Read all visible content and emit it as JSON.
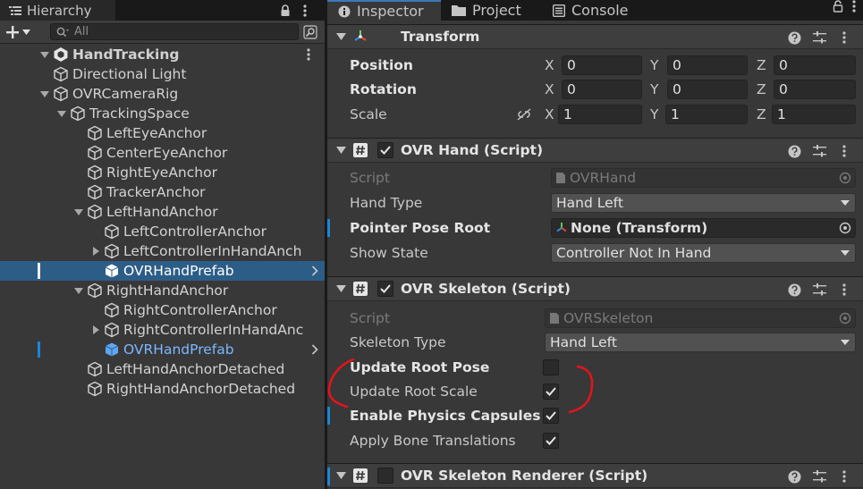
{
  "colors": {
    "selection": "#2c5d87",
    "accent": "#1b86d8",
    "prefab_text": "#7cb7ff",
    "annotation": "#e8121b"
  },
  "hierarchy": {
    "tab_label": "Hierarchy",
    "tab_icon": "list-icon",
    "search_placeholder": "All",
    "items": [
      {
        "label": "HandTracking",
        "depth": 0,
        "arrow": "open",
        "icon": "unity-scene-icon"
      },
      {
        "label": "Directional Light",
        "depth": 1,
        "arrow": "none",
        "icon": "cube-icon"
      },
      {
        "label": "OVRCameraRig",
        "depth": 1,
        "arrow": "open",
        "icon": "cube-icon"
      },
      {
        "label": "TrackingSpace",
        "depth": 2,
        "arrow": "open",
        "icon": "cube-icon"
      },
      {
        "label": "LeftEyeAnchor",
        "depth": 3,
        "arrow": "none",
        "icon": "cube-icon"
      },
      {
        "label": "CenterEyeAnchor",
        "depth": 3,
        "arrow": "none",
        "icon": "cube-icon"
      },
      {
        "label": "RightEyeAnchor",
        "depth": 3,
        "arrow": "none",
        "icon": "cube-icon"
      },
      {
        "label": "TrackerAnchor",
        "depth": 3,
        "arrow": "none",
        "icon": "cube-icon"
      },
      {
        "label": "LeftHandAnchor",
        "depth": 3,
        "arrow": "open",
        "icon": "cube-icon"
      },
      {
        "label": "LeftControllerAnchor",
        "depth": 4,
        "arrow": "none",
        "icon": "cube-icon"
      },
      {
        "label": "LeftControllerInHandAnch",
        "depth": 4,
        "arrow": "closed",
        "icon": "cube-icon"
      },
      {
        "label": "OVRHandPrefab",
        "depth": 4,
        "arrow": "none",
        "icon": "prefab-icon"
      },
      {
        "label": "RightHandAnchor",
        "depth": 3,
        "arrow": "open",
        "icon": "cube-icon"
      },
      {
        "label": "RightControllerAnchor",
        "depth": 4,
        "arrow": "none",
        "icon": "cube-icon"
      },
      {
        "label": "RightControllerInHandAnc",
        "depth": 4,
        "arrow": "closed",
        "icon": "cube-icon"
      },
      {
        "label": "OVRHandPrefab",
        "depth": 4,
        "arrow": "none",
        "icon": "prefab-icon"
      },
      {
        "label": "LeftHandAnchorDetached",
        "depth": 3,
        "arrow": "none",
        "icon": "cube-icon"
      },
      {
        "label": "RightHandAnchorDetached",
        "depth": 3,
        "arrow": "none",
        "icon": "cube-icon"
      }
    ]
  },
  "inspector": {
    "tabs": [
      {
        "label": "Inspector",
        "icon": "info-icon"
      },
      {
        "label": "Project",
        "icon": "folder-icon"
      },
      {
        "label": "Console",
        "icon": "console-icon"
      }
    ],
    "transform": {
      "title": "Transform",
      "position": {
        "label": "Position",
        "x": "0",
        "y": "0",
        "z": "0"
      },
      "rotation": {
        "label": "Rotation",
        "x": "0",
        "y": "0",
        "z": "0"
      },
      "scale": {
        "label": "Scale",
        "x": "1",
        "y": "1",
        "z": "1"
      },
      "axis_x": "X",
      "axis_y": "Y",
      "axis_z": "Z"
    },
    "ovr_hand": {
      "title": "OVR Hand (Script)",
      "script_label": "Script",
      "script_value": "OVRHand",
      "hand_type_label": "Hand Type",
      "hand_type_value": "Hand Left",
      "pointer_label": "Pointer Pose Root",
      "pointer_value": "None (Transform)",
      "show_state_label": "Show State",
      "show_state_value": "Controller Not In Hand"
    },
    "ovr_skeleton": {
      "title": "OVR Skeleton (Script)",
      "script_label": "Script",
      "script_value": "OVRSkeleton",
      "skeleton_type_label": "Skeleton Type",
      "skeleton_type_value": "Hand Left",
      "update_root_pose_label": "Update Root Pose",
      "update_root_pose": false,
      "update_root_scale_label": "Update Root Scale",
      "update_root_scale": true,
      "enable_physics_label": "Enable Physics Capsules",
      "enable_physics": true,
      "apply_bone_label": "Apply Bone Translations",
      "apply_bone": true
    },
    "ovr_skeleton_renderer": {
      "title": "OVR Skeleton Renderer (Script)"
    }
  }
}
